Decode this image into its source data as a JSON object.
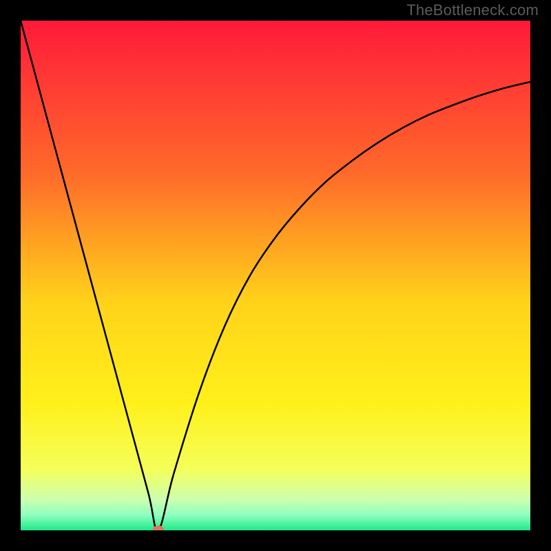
{
  "watermark": "TheBottleneck.com",
  "chart_data": {
    "type": "line",
    "title": "",
    "xlabel": "",
    "ylabel": "",
    "xlim": [
      0,
      100
    ],
    "ylim": [
      0,
      100
    ],
    "background_gradient": {
      "stops": [
        {
          "offset": 0.0,
          "color": "#ff1a3a"
        },
        {
          "offset": 0.3,
          "color": "#ff6a2a"
        },
        {
          "offset": 0.55,
          "color": "#ffd21a"
        },
        {
          "offset": 0.75,
          "color": "#fff01a"
        },
        {
          "offset": 0.88,
          "color": "#f5ff5a"
        },
        {
          "offset": 0.94,
          "color": "#ccffb0"
        },
        {
          "offset": 0.97,
          "color": "#8fffc0"
        },
        {
          "offset": 1.0,
          "color": "#20e88a"
        }
      ]
    },
    "marker": {
      "x": 27,
      "y": 0,
      "color": "#d97a5a"
    },
    "series": [
      {
        "name": "curve",
        "x": [
          0,
          5,
          10,
          15,
          20,
          25,
          27,
          30,
          35,
          40,
          45,
          50,
          55,
          60,
          65,
          70,
          75,
          80,
          85,
          90,
          95,
          100
        ],
        "values": [
          100,
          81.5,
          63,
          44.5,
          26,
          7.5,
          0,
          11,
          27,
          40,
          50,
          57.5,
          63.5,
          68.5,
          72.5,
          76,
          79,
          81.5,
          83.5,
          85.3,
          86.8,
          88
        ]
      }
    ]
  }
}
